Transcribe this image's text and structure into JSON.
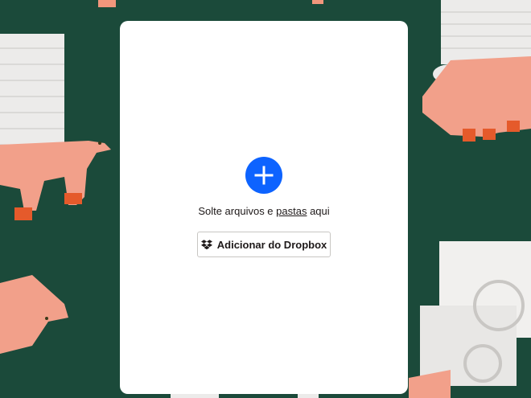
{
  "dropzone": {
    "add_icon": "plus-icon",
    "text_prefix": "Solte arquivos e ",
    "text_link": "pastas",
    "text_suffix": " aqui",
    "dropbox_button_label": "Adicionar do Dropbox",
    "dropbox_icon": "dropbox-icon"
  },
  "colors": {
    "background": "#1b4a3a",
    "accent": "#0d63ff",
    "card": "#ffffff"
  }
}
